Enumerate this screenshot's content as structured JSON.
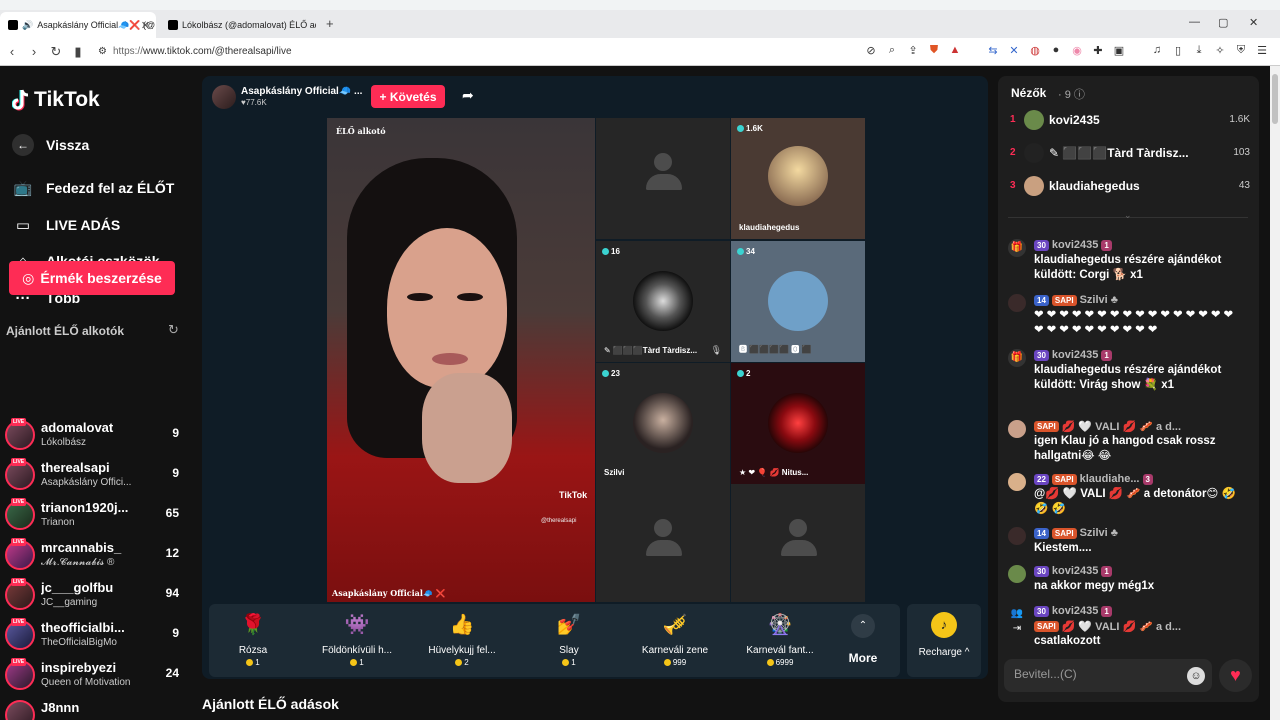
{
  "browser": {
    "tabs": [
      {
        "label": "Asapkáslány Official🧢❌ (@",
        "active": true
      },
      {
        "label": "Lókolbász (@adomalovat) ÉLŐ adásk",
        "active": false
      }
    ],
    "new_tab": "+",
    "url_scheme": "https://",
    "url_rest": "www.tiktok.com/@therealsapi/live",
    "window": {
      "minimize": "—",
      "maximize": "▢",
      "close": "✕"
    }
  },
  "sidebar": {
    "logo": "TikTok",
    "back": "Vissza",
    "nav": [
      {
        "label": "Fedezd fel az ÉLŐT",
        "icon": "tv-icon"
      },
      {
        "label": "LIVE ADÁS",
        "icon": "camera-icon"
      },
      {
        "label": "Alkotói eszközök",
        "icon": "home-icon"
      },
      {
        "label": "Több",
        "icon": "more-icon"
      }
    ],
    "coins_button": "Érmék beszerzése",
    "recommended_title": "Ajánlott ÉLŐ alkotók",
    "creators": [
      {
        "name": "adomalovat",
        "sub": "Lókolbász",
        "count": "9"
      },
      {
        "name": "therealsapi",
        "sub": "Asapkáslány Offici...",
        "count": "9"
      },
      {
        "name": "trianon1920j...",
        "sub": "Trianon",
        "count": "65"
      },
      {
        "name": "mrcannabis_",
        "sub": "𝓜𝓻.𝓒𝓪𝓷𝓷𝓪𝓫𝓲𝓼 ®",
        "count": "12"
      },
      {
        "name": "jc___golfbu",
        "sub": "JC__gaming",
        "count": "94"
      },
      {
        "name": "theofficialbi...",
        "sub": "TheOfficialBigMo",
        "count": "9"
      },
      {
        "name": "inspirebyezi",
        "sub": "Queen of Motivation",
        "count": "24"
      },
      {
        "name": "J8nnn",
        "sub": "",
        "count": ""
      }
    ],
    "live_badge": "LIVE"
  },
  "stream": {
    "host_name": "Asapkáslány Official🧢 ...",
    "host_likes": "♥77.6K",
    "follow": "+ Követés",
    "main_label": "ÉLŐ alkotó",
    "main_bottom": "Asapkáslány Official🧢 ❌",
    "watermark": "TikTok",
    "watermark_handle": "@therealsapi",
    "tiles": [
      {
        "badge": "",
        "name": ""
      },
      {
        "badge": "1.6K",
        "name": "klaudiahegedus"
      },
      {
        "badge": "16",
        "name": "✎ ⬛⬛⬛Tàrd Tàrdisz..."
      },
      {
        "badge": "34",
        "name": "🅱 ⬛⬛⬛⬛ 🅾 ⬛"
      },
      {
        "badge": "23",
        "name": "Szilvi"
      },
      {
        "badge": "2",
        "name": "★ ❤ 🎈 💋 Nitus..."
      },
      {
        "badge": "",
        "name": ""
      },
      {
        "badge": "",
        "name": ""
      }
    ]
  },
  "gifts": [
    {
      "name": "Rózsa",
      "price": "1",
      "icon": "🌹"
    },
    {
      "name": "Földönkívüli h...",
      "price": "1",
      "icon": "👾"
    },
    {
      "name": "Hüvelykujj fel...",
      "price": "2",
      "icon": "👍"
    },
    {
      "name": "Slay",
      "price": "1",
      "icon": "💅"
    },
    {
      "name": "Karneváli zene",
      "price": "999",
      "icon": "🎺"
    },
    {
      "name": "Karnevál fant...",
      "price": "6999",
      "icon": "🎡"
    }
  ],
  "gift_more": "More",
  "recharge": "Recharge ^",
  "recommended_live_title": "Ajánlott ÉLŐ adások",
  "chat": {
    "viewers_title": "Nézők",
    "viewers_count": "· 9",
    "viewers": [
      {
        "rank": "1",
        "name": "kovi2435",
        "score": "1.6K"
      },
      {
        "rank": "2",
        "name": "✎ ⬛⬛⬛Tàrd Tàrdisz...",
        "score": "103"
      },
      {
        "rank": "3",
        "name": "klaudiahegedus",
        "score": "43"
      }
    ],
    "messages": [
      {
        "badges": [
          "30",
          "1"
        ],
        "user": "kovi2435",
        "text": "klaudiahegedus részére ajándékot küldött: Corgi 🐕 x1"
      },
      {
        "badges": [
          "14",
          "SAPI"
        ],
        "user": "Szilvi ♣",
        "text": "❤❤❤❤❤❤❤❤❤❤❤❤❤❤❤❤❤❤❤❤❤❤❤❤❤❤"
      },
      {
        "badges": [
          "30",
          "1"
        ],
        "user": "kovi2435",
        "text": "klaudiahegedus részére ajándékot küldött: Virág show 💐 x1"
      },
      {
        "badges": [
          "SAPI"
        ],
        "user": "💋 🤍 VALI 💋 🥓 a d...",
        "text": "igen Klau jó a hangod csak rossz hallgatni😂 😂"
      },
      {
        "badges": [
          "22",
          "SAPI",
          "3"
        ],
        "user": "klaudiahe...",
        "text": "@💋 🤍 VALI 💋 🥓 a detonátor😊 🤣 🤣 🤣"
      },
      {
        "badges": [
          "14",
          "SAPI"
        ],
        "user": "Szilvi ♣",
        "text": "Kiestem...."
      },
      {
        "badges": [
          "30",
          "1"
        ],
        "user": "kovi2435",
        "text": "na akkor megy még1x"
      },
      {
        "badges": [
          "30",
          "1"
        ],
        "user": "kovi2435",
        "text": ""
      },
      {
        "badges": [
          "SAPI"
        ],
        "user": "💋 🤍 VALI 💋 🥓 a d...",
        "text": "csatlakozott"
      }
    ],
    "input_placeholder": "Bevitel...(C)"
  }
}
